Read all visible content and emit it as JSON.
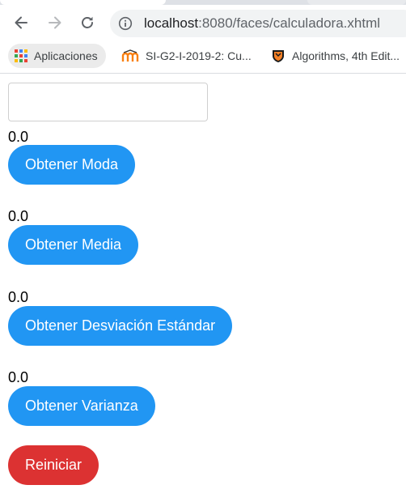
{
  "browser": {
    "url_host": "localhost",
    "url_path": ":8080/faces/calculadora.xhtml"
  },
  "bookmarks": [
    {
      "label": "Aplicaciones",
      "icon": "apps-grid-icon"
    },
    {
      "label": "SI-G2-I-2019-2: Cu...",
      "icon": "moodle-icon"
    },
    {
      "label": "Algorithms, 4th Edit...",
      "icon": "princeton-shield-icon"
    }
  ],
  "form": {
    "input_value": "",
    "results": [
      {
        "value": "0.0",
        "button": "Obtener Moda"
      },
      {
        "value": "0.0",
        "button": "Obtener Media"
      },
      {
        "value": "0.0",
        "button": "Obtener Desviación Estándar"
      },
      {
        "value": "0.0",
        "button": "Obtener Varianza"
      }
    ],
    "reset_label": "Reiniciar"
  },
  "colors": {
    "primary_button": "#2196f3",
    "danger_button": "#dc3232"
  }
}
